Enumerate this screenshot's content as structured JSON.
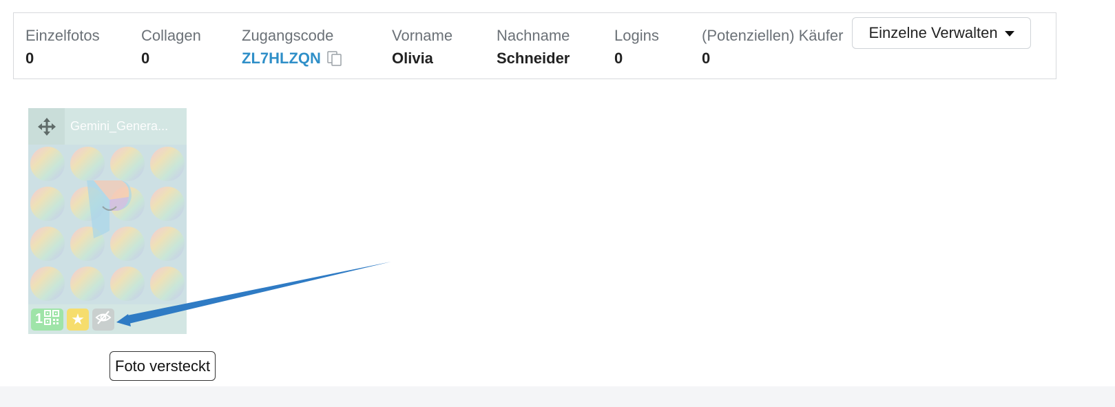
{
  "stats": [
    {
      "label": "Einzelfotos",
      "value": "0"
    },
    {
      "label": "Collagen",
      "value": "0"
    },
    {
      "label": "Zugangscode",
      "value": "ZL7HLZQN"
    },
    {
      "label": "Vorname",
      "value": "Olivia"
    },
    {
      "label": "Nachname",
      "value": "Schneider"
    },
    {
      "label": "Logins",
      "value": "0"
    },
    {
      "label": "(Potenziellen) Käufer",
      "value": "0"
    }
  ],
  "manage_button": {
    "label": "Einzelne Verwalten"
  },
  "photo": {
    "file_name": "Gemini_Genera...",
    "qr_count": "1",
    "star_glyph": "★"
  },
  "tooltip": {
    "text": "Foto versteckt"
  },
  "colors": {
    "link": "#2f8fc8",
    "qr_badge": "#9fe4a8",
    "star_badge": "#f6dd6d",
    "hidden_badge": "#c9cfce",
    "annotation_arrow": "#2f7bc4"
  },
  "icons": {
    "copy": "copy-icon",
    "drag": "move-icon",
    "qr": "qr-code-icon",
    "favorite": "star-icon",
    "hidden": "eye-slash-icon",
    "dropdown": "caret-down-icon"
  }
}
